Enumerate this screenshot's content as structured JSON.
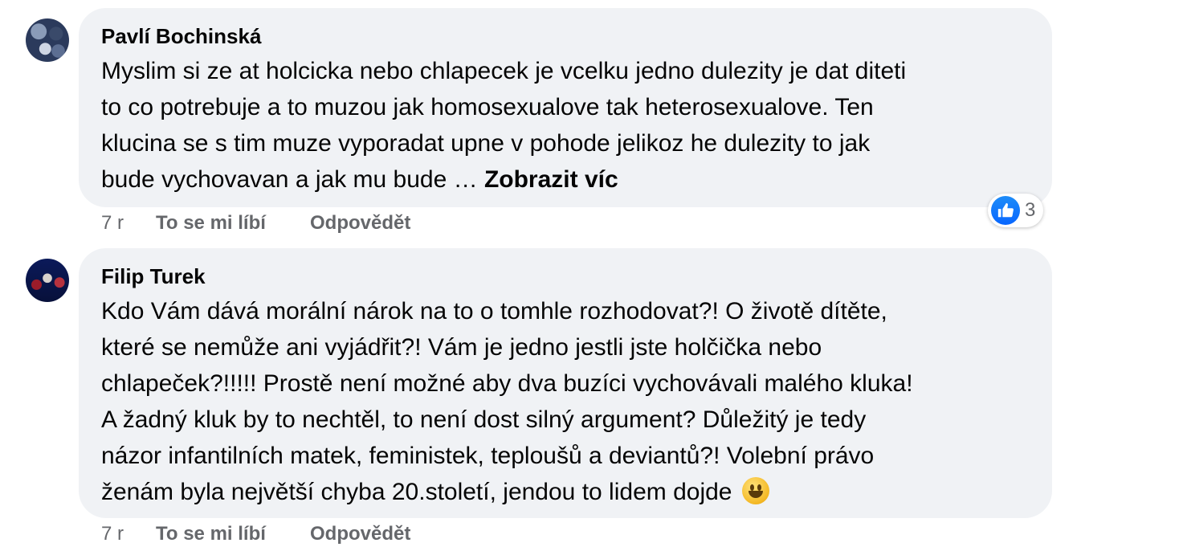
{
  "comments": [
    {
      "author": "Pavlí Bochinská",
      "text": "Myslim si ze at holcicka nebo chlapecek je vcelku jedno dulezity je dat diteti\nto co potrebuje a to muzou jak homosexualove tak heterosexualove. Ten\nklucina se s tim muze vyporadat upne v pohode jelikoz he dulezity to jak\nbude vychovavan a jak mu bude … ",
      "see_more": "Zobrazit víc",
      "time": "7 r",
      "like": "To se mi líbí",
      "reply": "Odpovědět",
      "reaction_count": "3",
      "reaction_icon": "thumbs-up-icon"
    },
    {
      "author": "Filip Turek",
      "text": "Kdo Vám dává morální nárok na to o tomhle rozhodovat?! O životě dítěte,\nkteré se nemůže ani vyjádřit?! Vám je jedno jestli jste holčička nebo\nchlapeček?!!!!! Prostě není možné aby dva buzíci vychovávali malého kluka!\nA žadný kluk by to nechtěl, to není dost silný argument? Důležitý je tedy\nnázor infantilních matek, feministek, teploušů a deviantů?! Volební právo\nženám byla největší chyba 20.století, jendou to lidem dojde ",
      "emoji": "grinning-face-emoji",
      "time": "7 r",
      "like": "To se mi líbí",
      "reply": "Odpovědět"
    }
  ]
}
